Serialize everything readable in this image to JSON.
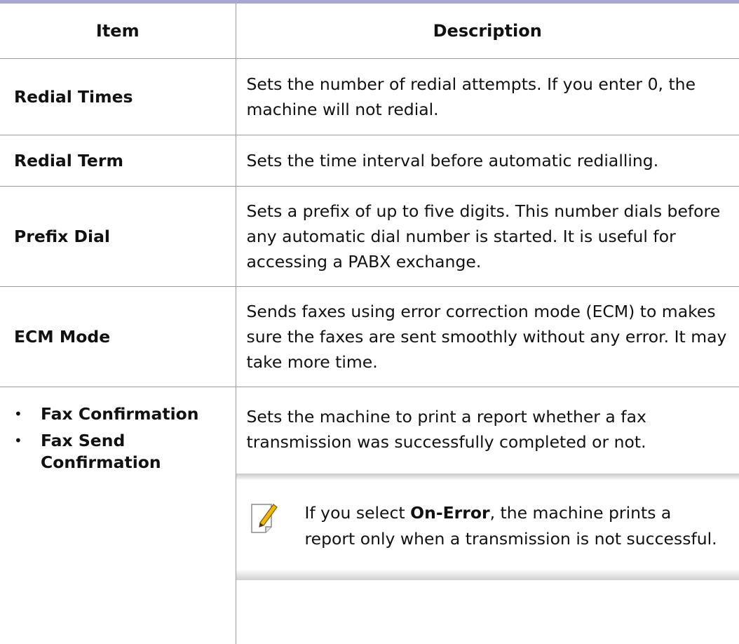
{
  "table": {
    "headers": {
      "item": "Item",
      "description": "Description"
    },
    "rows": [
      {
        "item": "Redial Times",
        "description": "Sets the number of redial attempts. If you enter 0, the machine will not redial."
      },
      {
        "item": "Redial Term",
        "description": "Sets the time interval before automatic redialling."
      },
      {
        "item": "Prefix Dial",
        "description": "Sets a prefix of up to five digits. This number dials before any automatic dial number is started. It is useful for accessing a PABX exchange."
      },
      {
        "item": "ECM Mode",
        "description": "Sends faxes using error correction mode (ECM) to makes sure the faxes are sent smoothly without any error. It may take more time."
      }
    ],
    "last_row": {
      "bullet": "•",
      "items": [
        "Fax Confirmation",
        "Fax Send Confirmation"
      ],
      "description": "Sets the machine to print a report whether a fax transmission was successfully completed or not.",
      "note": {
        "icon": "note-pencil-icon",
        "prefix": " If you select ",
        "bold": "On-Error",
        "suffix": ", the machine prints a report only when a transmission is not successful."
      }
    }
  },
  "colors": {
    "header_bar": "#a9a6d4",
    "rule": "#9a9a9a",
    "note_shade": "#c8c8c8"
  }
}
